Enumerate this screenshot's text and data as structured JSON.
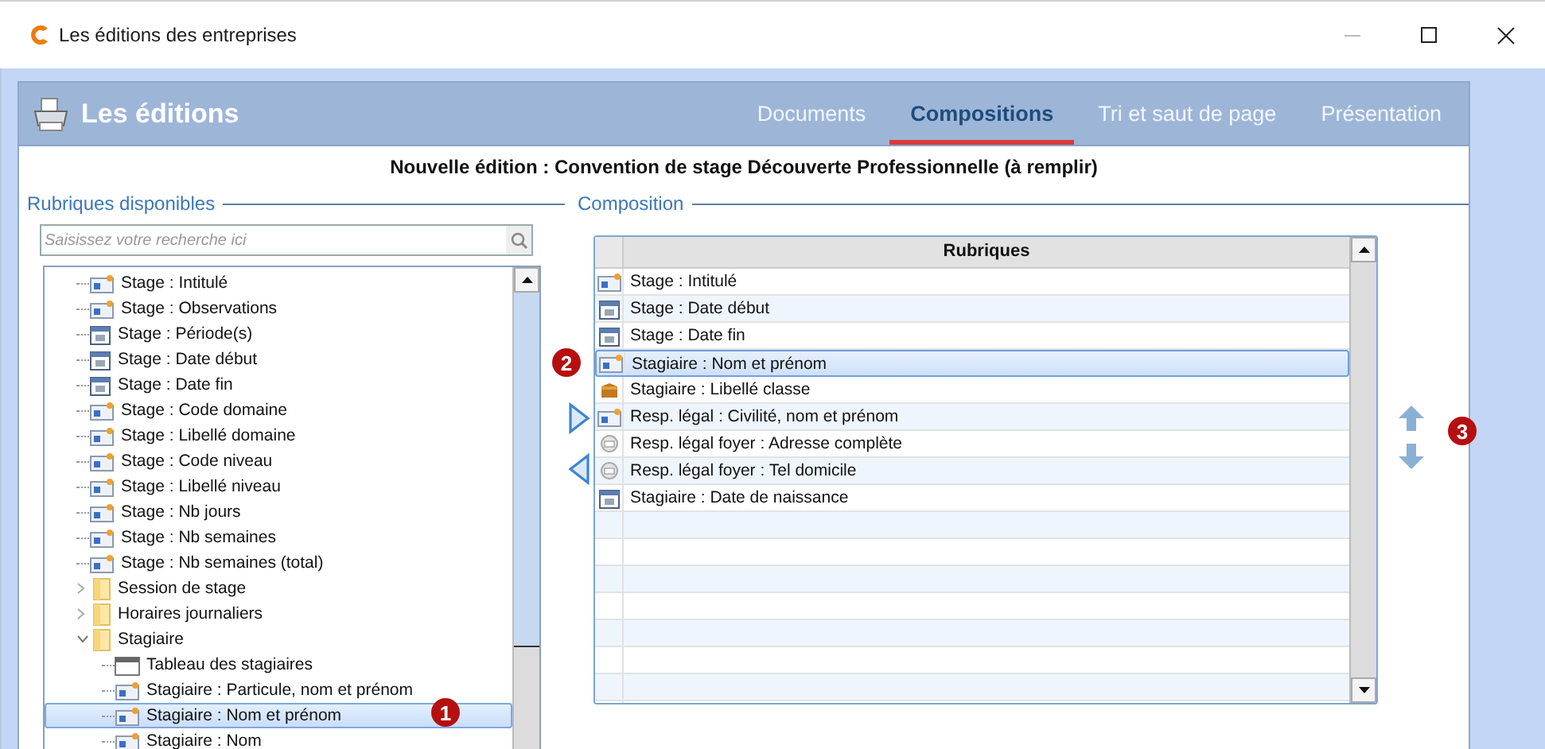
{
  "window": {
    "title": "Les éditions des entreprises"
  },
  "header": {
    "title": "Les éditions"
  },
  "tabs": [
    {
      "label": "Documents",
      "selected": false
    },
    {
      "label": "Compositions",
      "selected": true
    },
    {
      "label": "Tri et saut de page",
      "selected": false
    },
    {
      "label": "Présentation",
      "selected": false
    }
  ],
  "edition_title": "Nouvelle édition : Convention de stage Découverte Professionnelle (à remplir)",
  "available": {
    "legend": "Rubriques disponibles",
    "search": {
      "placeholder": "Saisissez votre recherche ici"
    },
    "callout": "1",
    "tree": [
      {
        "label": "Stage : Intitulé",
        "kind": "text",
        "selected": false
      },
      {
        "label": "Stage : Observations",
        "kind": "text",
        "selected": false
      },
      {
        "label": "Stage : Période(s)",
        "kind": "date",
        "selected": false
      },
      {
        "label": "Stage : Date début",
        "kind": "date",
        "selected": false
      },
      {
        "label": "Stage : Date fin",
        "kind": "date",
        "selected": false
      },
      {
        "label": "Stage : Code domaine",
        "kind": "text",
        "selected": false
      },
      {
        "label": "Stage : Libellé domaine",
        "kind": "text",
        "selected": false
      },
      {
        "label": "Stage : Code niveau",
        "kind": "text",
        "selected": false
      },
      {
        "label": "Stage : Libellé niveau",
        "kind": "text",
        "selected": false
      },
      {
        "label": "Stage : Nb jours",
        "kind": "text",
        "selected": false
      },
      {
        "label": "Stage : Nb semaines",
        "kind": "text",
        "selected": false
      },
      {
        "label": "Stage : Nb semaines (total)",
        "kind": "text",
        "selected": false
      },
      {
        "label": "Session de stage",
        "kind": "folder",
        "expanded": false,
        "selected": false
      },
      {
        "label": "Horaires journaliers",
        "kind": "folder",
        "expanded": false,
        "selected": false
      },
      {
        "label": "Stagiaire",
        "kind": "folder",
        "expanded": true,
        "selected": false,
        "children": [
          {
            "label": "Tableau des stagiaires",
            "kind": "table",
            "selected": false
          },
          {
            "label": "Stagiaire : Particule, nom et prénom",
            "kind": "text",
            "selected": false
          },
          {
            "label": "Stagiaire : Nom et prénom",
            "kind": "text",
            "selected": true
          },
          {
            "label": "Stagiaire : Nom",
            "kind": "text",
            "selected": false
          }
        ]
      }
    ]
  },
  "composition": {
    "legend": "Composition",
    "column": "Rubriques",
    "callout": "2",
    "rows": [
      {
        "label": "Stage : Intitulé",
        "kind": "text",
        "selected": false
      },
      {
        "label": "Stage : Date début",
        "kind": "date",
        "selected": false
      },
      {
        "label": "Stage : Date fin",
        "kind": "date",
        "selected": false
      },
      {
        "label": "Stagiaire : Nom et prénom",
        "kind": "text",
        "selected": true
      },
      {
        "label": "Stagiaire : Libellé classe",
        "kind": "class",
        "selected": false
      },
      {
        "label": "Resp. légal : Civilité, nom et prénom",
        "kind": "text",
        "selected": false
      },
      {
        "label": "Resp. légal foyer : Adresse complète",
        "kind": "address",
        "selected": false
      },
      {
        "label": "Resp. légal foyer : Tel domicile",
        "kind": "address",
        "selected": false
      },
      {
        "label": "Stagiaire : Date de naissance",
        "kind": "date",
        "selected": false
      }
    ]
  },
  "order_callout": "3"
}
